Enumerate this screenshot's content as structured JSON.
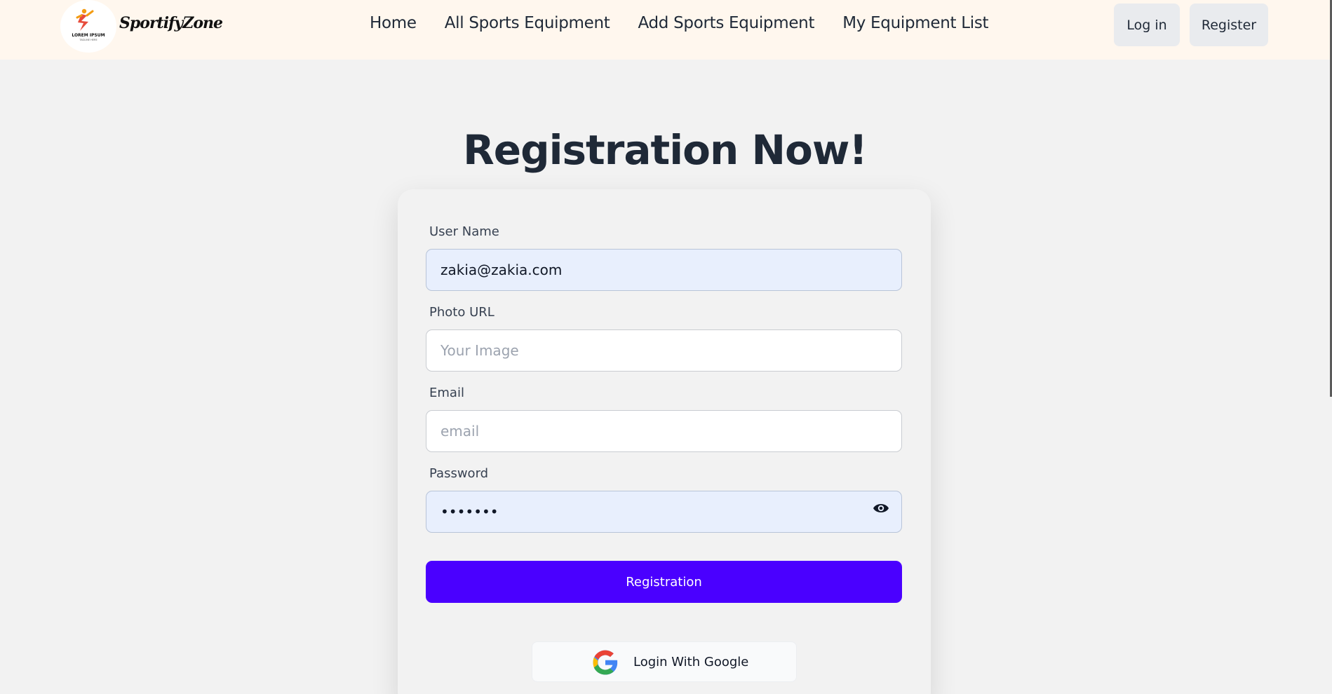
{
  "navbar": {
    "logo_text": "LOREM IPSUM",
    "logo_tagline": "TAGLINE HERE",
    "brand": "SportifyZone",
    "links": [
      {
        "label": "Home"
      },
      {
        "label": "All Sports Equipment"
      },
      {
        "label": "Add Sports Equipment"
      },
      {
        "label": "My Equipment List"
      }
    ],
    "login_label": "Log in",
    "register_label": "Register"
  },
  "page": {
    "title": "Registration Now!"
  },
  "form": {
    "username": {
      "label": "User Name",
      "value": "zakia@zakia.com",
      "placeholder": ""
    },
    "photo": {
      "label": "Photo URL",
      "value": "",
      "placeholder": "Your Image"
    },
    "email": {
      "label": "Email",
      "value": "",
      "placeholder": "email"
    },
    "password": {
      "label": "Password",
      "value": "1234567",
      "placeholder": ""
    },
    "submit_label": "Registration",
    "google_label": "Login With Google"
  },
  "colors": {
    "navbar_bg": "#fff7ee",
    "page_bg": "#f2f2f2",
    "primary": "#4a00ff",
    "autofill_bg": "#e8effd"
  },
  "icons": [
    "logo-emblem-icon",
    "eye-icon",
    "google-icon"
  ]
}
